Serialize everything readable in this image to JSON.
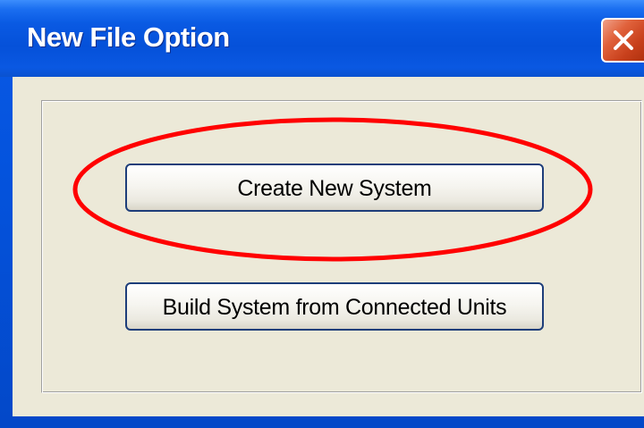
{
  "window": {
    "title": "New File Option"
  },
  "buttons": {
    "create_new_system": "Create New System",
    "build_system": "Build System from Connected Units"
  },
  "icons": {
    "close": "close-icon"
  },
  "annotation": {
    "highlight_color": "#ff0000"
  }
}
